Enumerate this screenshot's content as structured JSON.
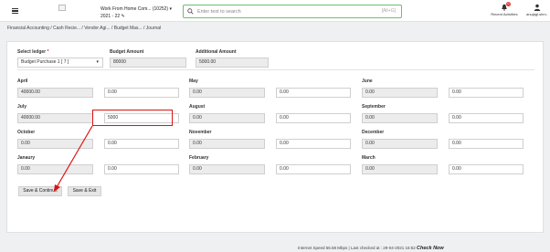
{
  "header": {
    "company_name": "Work From Home Com... (10252)",
    "fiscal_year": "2021 - 22",
    "search_placeholder": "Enter text to search",
    "search_shortcut": "[Alt+G]",
    "recent_label": "Recent Activities",
    "recent_count": "0",
    "user_label": "anujagl.shm.."
  },
  "breadcrumb": "Financial Accounting  / Cash Recie...  / Vendor Agi...  / Budget Mas...  / Journal",
  "form": {
    "select_ledger_label": "Select ledger",
    "select_ledger_value": "Budget Purchase 1 [ 7 ]",
    "budget_amount_label": "Budget Amount",
    "budget_amount_value": "80000",
    "additional_amount_label": "Additional Amount",
    "additional_amount_value": "5000.00"
  },
  "months": [
    {
      "name": "April",
      "ro": "40000.00",
      "value": "0.00"
    },
    {
      "name": "May",
      "ro": "0.00",
      "value": "0.00"
    },
    {
      "name": "June",
      "ro": "0.00",
      "value": "0.00"
    },
    {
      "name": "July",
      "ro": "40000.00",
      "value": "5000"
    },
    {
      "name": "August",
      "ro": "0.00",
      "value": "0.00"
    },
    {
      "name": "September",
      "ro": "0.00",
      "value": "0.00"
    },
    {
      "name": "October",
      "ro": "0.00",
      "value": "0.00"
    },
    {
      "name": "November",
      "ro": "0.00",
      "value": "0.00"
    },
    {
      "name": "December",
      "ro": "0.00",
      "value": "0.00"
    },
    {
      "name": "Janaury",
      "ro": "0.00",
      "value": "0.00"
    },
    {
      "name": "February",
      "ro": "0.00",
      "value": "0.00"
    },
    {
      "name": "March",
      "ro": "0.00",
      "value": "0.00"
    }
  ],
  "buttons": {
    "save_continue": "Save & Continue",
    "save_exit": "Save & Exit"
  },
  "footer": {
    "status": "Internet Speed 56.68 Mbps | Last checked at : 29-04-2021 16:52",
    "check_now": "Check Now"
  },
  "colors": {
    "highlight": "#dd1111",
    "search_border": "#6abf6a",
    "required": "#d32f2f"
  }
}
